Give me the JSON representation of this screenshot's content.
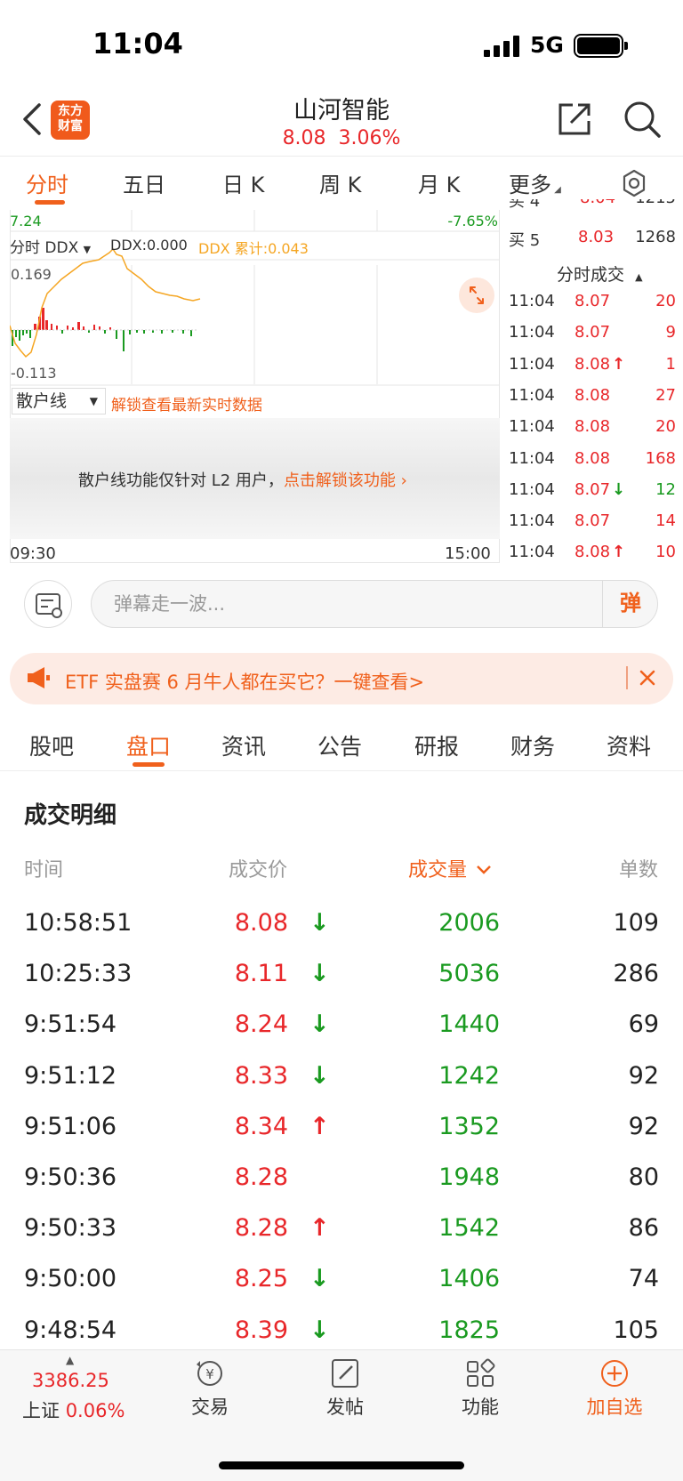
{
  "status_bar": {
    "time": "11:04",
    "network": "5G"
  },
  "header": {
    "logo_text_1": "东方",
    "logo_text_2": "财富",
    "stock_name": "山河智能",
    "price": "8.08",
    "change_pct": "3.06%"
  },
  "chart_tabs": [
    "分时",
    "五日",
    "日 K",
    "周 K",
    "月 K",
    "更多"
  ],
  "chart": {
    "top_left_value": "7.24",
    "top_right_value": "-7.65%",
    "ddx_select": "分时 DDX",
    "ddx_value": "DDX:0.000",
    "ddx_cumulative": "DDX 累计:0.043",
    "ddx_high": "0.169",
    "ddx_low": "-0.113",
    "scatter_select": "散户线",
    "unlock_text": "解锁查看最新实时数据",
    "l2_notice": "散户线功能仅针对 L2 用户，",
    "l2_link": "点击解锁该功能",
    "time_start": "09:30",
    "time_end": "15:00"
  },
  "order_book": {
    "ask5_label": "买 5",
    "ask5_price": "8.03",
    "ask5_volume": "1268"
  },
  "tick_header": "分时成交",
  "ticks": [
    {
      "time": "11:04",
      "price": "8.07",
      "arrow": "",
      "vol": "20",
      "color": "red"
    },
    {
      "time": "11:04",
      "price": "8.07",
      "arrow": "",
      "vol": "9",
      "color": "red"
    },
    {
      "time": "11:04",
      "price": "8.08",
      "arrow": "↑",
      "vol": "1",
      "color": "red"
    },
    {
      "time": "11:04",
      "price": "8.08",
      "arrow": "",
      "vol": "27",
      "color": "red"
    },
    {
      "time": "11:04",
      "price": "8.08",
      "arrow": "",
      "vol": "20",
      "color": "red"
    },
    {
      "time": "11:04",
      "price": "8.08",
      "arrow": "",
      "vol": "168",
      "color": "red"
    },
    {
      "time": "11:04",
      "price": "8.07",
      "arrow": "↓",
      "vol": "12",
      "color": "green"
    },
    {
      "time": "11:04",
      "price": "8.07",
      "arrow": "",
      "vol": "14",
      "color": "red"
    },
    {
      "time": "11:04",
      "price": "8.08",
      "arrow": "↑",
      "vol": "10",
      "color": "red"
    }
  ],
  "danmaku": {
    "placeholder": "弹幕走一波...",
    "button": "弹"
  },
  "banner": {
    "text": "ETF 实盘赛 6 月牛人都在买它？一键查看>"
  },
  "section_tabs": [
    "股吧",
    "盘口",
    "资讯",
    "公告",
    "研报",
    "财务",
    "资料"
  ],
  "detail": {
    "title": "成交明细",
    "headers": {
      "time": "时间",
      "price": "成交价",
      "volume": "成交量",
      "count": "单数"
    },
    "rows": [
      {
        "time": "10:58:51",
        "price": "8.08",
        "dir": "↓",
        "volume": "2006",
        "count": "109"
      },
      {
        "time": "10:25:33",
        "price": "8.11",
        "dir": "↓",
        "volume": "5036",
        "count": "286"
      },
      {
        "time": "9:51:54",
        "price": "8.24",
        "dir": "↓",
        "volume": "1440",
        "count": "69"
      },
      {
        "time": "9:51:12",
        "price": "8.33",
        "dir": "↓",
        "volume": "1242",
        "count": "92"
      },
      {
        "time": "9:51:06",
        "price": "8.34",
        "dir": "↑",
        "volume": "1352",
        "count": "92"
      },
      {
        "time": "9:50:36",
        "price": "8.28",
        "dir": "",
        "volume": "1948",
        "count": "80"
      },
      {
        "time": "9:50:33",
        "price": "8.28",
        "dir": "↑",
        "volume": "1542",
        "count": "86"
      },
      {
        "time": "9:50:00",
        "price": "8.25",
        "dir": "↓",
        "volume": "1406",
        "count": "74"
      },
      {
        "time": "9:48:54",
        "price": "8.39",
        "dir": "↓",
        "volume": "1825",
        "count": "105"
      }
    ]
  },
  "bottom_bar": {
    "index_value": "3386.25",
    "index_name": "上证",
    "index_change": "0.06%",
    "trade": "交易",
    "post": "发帖",
    "function": "功能",
    "add_watch": "加自选"
  },
  "colors": {
    "accent": "#f0601c",
    "up": "#e8272a",
    "down": "#1a9a20"
  }
}
